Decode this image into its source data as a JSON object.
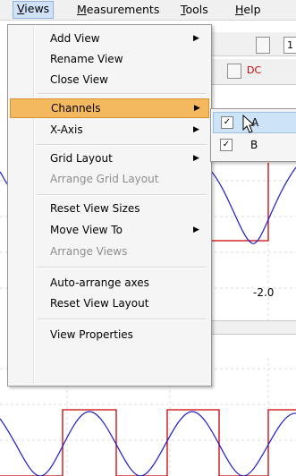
{
  "menubar": {
    "items": [
      "Views",
      "Measurements",
      "Tools",
      "Help"
    ]
  },
  "views_menu": {
    "items": [
      {
        "label": "Add View",
        "submenu": true
      },
      {
        "label": "Rename View"
      },
      {
        "label": "Close View"
      },
      {
        "label": "Channels",
        "submenu": true,
        "highlighted": true
      },
      {
        "label": "X-Axis",
        "submenu": true
      },
      {
        "label": "Grid Layout",
        "submenu": true
      },
      {
        "label": "Arrange Grid Layout",
        "disabled": true
      },
      {
        "label": "Reset View Sizes"
      },
      {
        "label": "Move View To",
        "submenu": true
      },
      {
        "label": "Arrange Views",
        "disabled": true
      },
      {
        "label": "Auto-arrange axes"
      },
      {
        "label": "Reset View Layout"
      },
      {
        "label": "View Properties"
      }
    ]
  },
  "channels_submenu": {
    "items": [
      {
        "label": "A",
        "checked": true
      },
      {
        "label": "B",
        "checked": true
      }
    ]
  },
  "background": {
    "toolbar_field": "1",
    "channel_label": "DC",
    "axis_tick": "-2.0"
  },
  "colors": {
    "signal_red": "#cc0000",
    "signal_blue": "#1a1acc",
    "menu_highlight": "#f4b95e"
  }
}
